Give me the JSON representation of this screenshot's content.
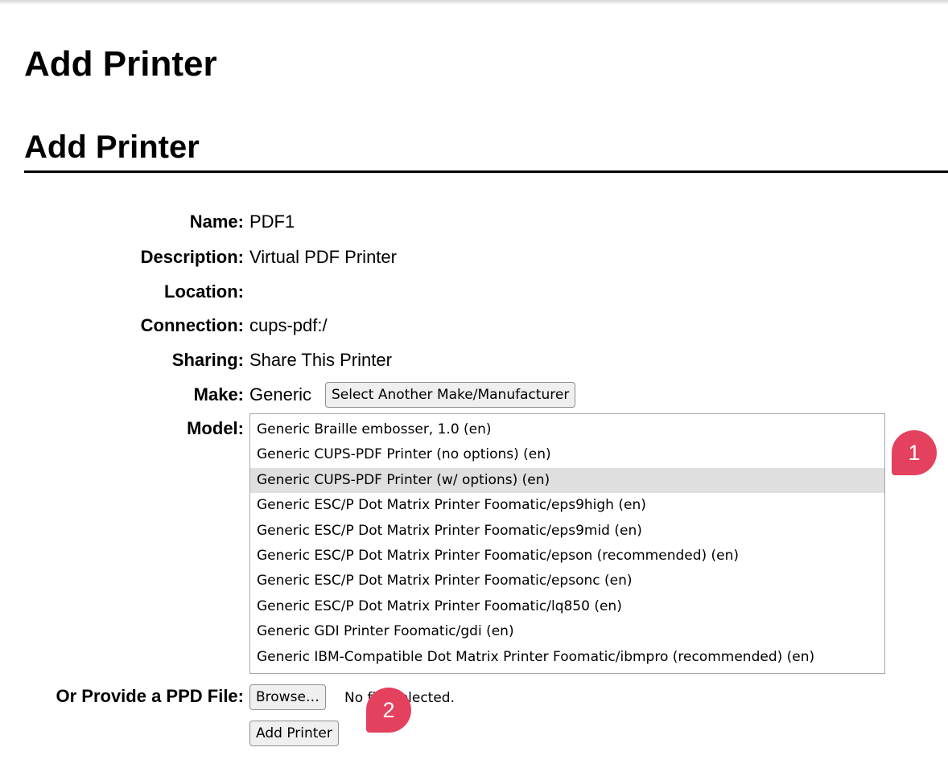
{
  "page": {
    "title": "Add Printer",
    "section_title": "Add Printer"
  },
  "form": {
    "name_label": "Name:",
    "name_value": "PDF1",
    "description_label": "Description:",
    "description_value": "Virtual PDF Printer",
    "location_label": "Location:",
    "location_value": "",
    "connection_label": "Connection:",
    "connection_value": "cups-pdf:/",
    "sharing_label": "Sharing:",
    "sharing_value": "Share This Printer",
    "make_label": "Make:",
    "make_value": "Generic",
    "make_button_label": "Select Another Make/Manufacturer",
    "model_label": "Model:",
    "model_options": [
      "Generic Braille embosser, 1.0 (en)",
      "Generic CUPS-PDF Printer (no options) (en)",
      "Generic CUPS-PDF Printer (w/ options) (en)",
      "Generic ESC/P Dot Matrix Printer Foomatic/eps9high (en)",
      "Generic ESC/P Dot Matrix Printer Foomatic/eps9mid (en)",
      "Generic ESC/P Dot Matrix Printer Foomatic/epson (recommended) (en)",
      "Generic ESC/P Dot Matrix Printer Foomatic/epsonc (en)",
      "Generic ESC/P Dot Matrix Printer Foomatic/lq850 (en)",
      "Generic GDI Printer Foomatic/gdi (en)",
      "Generic IBM-Compatible Dot Matrix Printer Foomatic/ibmpro (recommended) (en)"
    ],
    "model_selected_index": 2,
    "ppd_label": "Or Provide a PPD File:",
    "browse_button_label": "Browse…",
    "file_status": "No file selected.",
    "submit_button_label": "Add Printer"
  },
  "markers": [
    "1",
    "2"
  ],
  "colors": {
    "marker": "#e4415f",
    "selected_option": "#dfdfdf"
  }
}
